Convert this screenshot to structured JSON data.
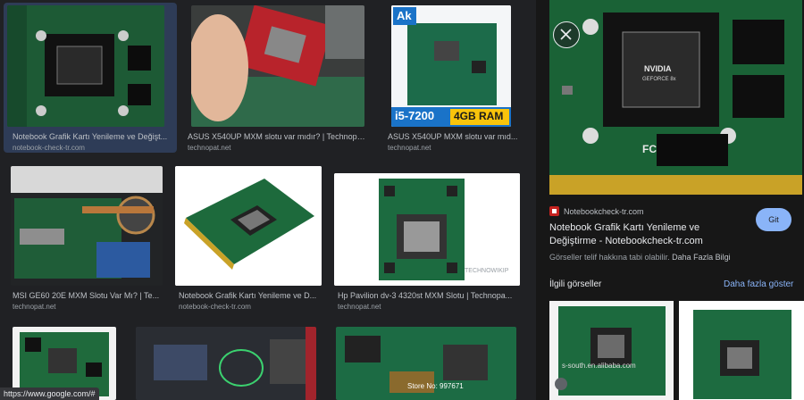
{
  "results": [
    {
      "caption": "Notebook Grafik Kartı Yenileme ve Değişt...",
      "source": "notebook-check-tr.com"
    },
    {
      "caption": "ASUS X540UP MXM slotu var mıdır? | Technopa...",
      "source": "technopat.net"
    },
    {
      "caption": "ASUS X540UP MXM slotu var mıd...",
      "source": "technopat.net",
      "overlay_brand": "Ak",
      "overlay_cpu": "i5-7200",
      "overlay_ram": "4GB RAM"
    },
    {
      "caption": "MSI GE60 20E MXM Slotu Var Mı? | Te...",
      "source": "technopat.net"
    },
    {
      "caption": "Notebook Grafik Kartı Yenileme ve D...",
      "source": "notebook-check-tr.com"
    },
    {
      "caption": "Hp Pavilion dv-3 4320st MXM Slotu | Technopa...",
      "source": "technopat.net",
      "watermark": "TECHNOWIKIP"
    },
    {
      "caption": "",
      "source": ""
    },
    {
      "caption": "",
      "source": ""
    },
    {
      "caption": "",
      "source": "",
      "watermark": "Store No: 997671"
    }
  ],
  "status_url": "https://www.google.com/#",
  "panel": {
    "site": "Notebookcheck-tr.com",
    "title": "Notebook Grafik Kartı Yenileme ve Değiştirme - Notebookcheck-tr.com",
    "go_label": "Git",
    "rights_text": "Görseller telif hakkına tabi olabilir.",
    "rights_more": "Daha Fazla Bilgi",
    "related_title": "İlgili görseller",
    "see_more": "Daha fazla göster",
    "related_watermark": "s-south.en.alibaba.com",
    "chip_labels": [
      "NVIDIA",
      "GEFORCE 8x",
      "FC"
    ]
  },
  "colors": {
    "background": "#202124",
    "panel": "#171717",
    "accent": "#8ab4f8",
    "pcb": "#1f6b3a"
  }
}
